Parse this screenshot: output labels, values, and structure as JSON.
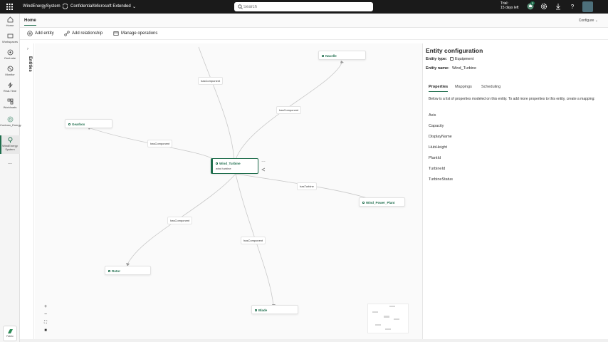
{
  "topbar": {
    "app_name": "WindEnergySystem",
    "sensitivity_label": "Confidential\\Microsoft Extended",
    "search_placeholder": "Search",
    "trial_line1": "Trial:",
    "trial_line2": "15 days left",
    "notification_count": "3"
  },
  "rail": {
    "items": [
      {
        "label": "Home",
        "icon": "home-icon"
      },
      {
        "label": "Workspaces",
        "icon": "workspaces-icon"
      },
      {
        "label": "OneLake",
        "icon": "onelake-icon"
      },
      {
        "label": "Monitor",
        "icon": "monitor-icon"
      },
      {
        "label": "Real-Time",
        "icon": "realtime-icon"
      },
      {
        "label": "Workloads",
        "icon": "workloads-icon"
      },
      {
        "label": "Contoso_Energy",
        "icon": "contoso-icon"
      },
      {
        "label": "WindEnergy System",
        "icon": "windenergy-icon"
      },
      {
        "label": "...",
        "icon": "more-icon"
      }
    ],
    "fabric_label": "Fabric"
  },
  "tabs": {
    "home": "Home",
    "configure": "Configure"
  },
  "ribbon": {
    "add_entity": "Add entity",
    "add_relationship": "Add relationship",
    "manage_operations": "Manage operations"
  },
  "entities_strip": {
    "label": "Entities"
  },
  "canvas": {
    "nodes": {
      "nacelle": "Nacelle",
      "gearbox": "Gearbox",
      "wind_turbine": "Wind_Turbine",
      "wind_turbine_sub": "wind turbine",
      "wind_power_plant": "Wind_Power_Plant",
      "rotor": "Rotor",
      "blade": "Blade"
    },
    "edges": {
      "top": "hasComponent",
      "nacelle": "hasComponent",
      "gearbox": "hasComponent",
      "plant": "hasTurbine",
      "rotor": "hasComponent",
      "blade": "hasComponent"
    }
  },
  "panel": {
    "title": "Entity configuration",
    "entity_type_label": "Entity type:",
    "entity_type_value": "Equipment",
    "entity_name_label": "Entity name:",
    "entity_name_value": "Wind_Turbine",
    "tabs": [
      "Properties",
      "Mappings",
      "Scheduling"
    ],
    "description": "Below is a list of properties modeled on this entity. To add more properties to this entity, create a mapping:",
    "properties": [
      "Axis",
      "Capacity",
      "DisplayName",
      "HubHeight",
      "PlantId",
      "TurbineId",
      "TurbineStatus"
    ]
  },
  "colors": {
    "accent": "#1f6e4d",
    "topbar_bg": "#1a1a1a"
  }
}
